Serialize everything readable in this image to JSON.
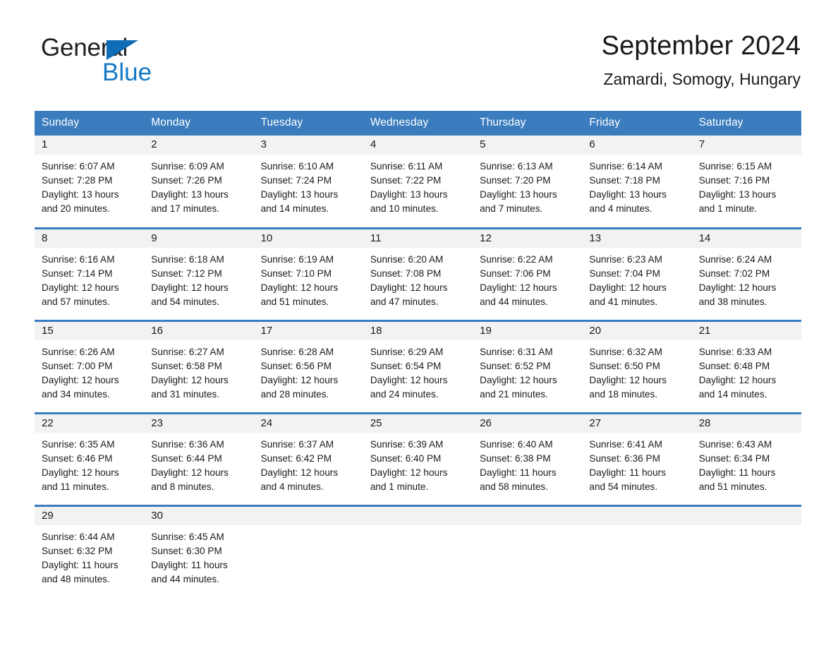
{
  "brand": {
    "name_primary": "General",
    "name_secondary": "Blue",
    "logo_icon": "triangle-flag-icon",
    "accent_color": "#1479c4"
  },
  "header": {
    "title": "September 2024",
    "subtitle": "Zamardi, Somogy, Hungary"
  },
  "theme": {
    "header_bar_color": "#3a7cbe",
    "day_cell_header_color": "#f2f2f2",
    "text_color": "#1a1a1a"
  },
  "weekday_headers": [
    "Sunday",
    "Monday",
    "Tuesday",
    "Wednesday",
    "Thursday",
    "Friday",
    "Saturday"
  ],
  "labels": {
    "sunrise_prefix": "Sunrise:",
    "sunset_prefix": "Sunset:",
    "daylight_prefix": "Daylight:"
  },
  "weeks": [
    {
      "days": [
        {
          "date": "1",
          "sunrise": "Sunrise: 6:07 AM",
          "sunset": "Sunset: 7:28 PM",
          "daylight_line1": "Daylight: 13 hours",
          "daylight_line2": "and 20 minutes."
        },
        {
          "date": "2",
          "sunrise": "Sunrise: 6:09 AM",
          "sunset": "Sunset: 7:26 PM",
          "daylight_line1": "Daylight: 13 hours",
          "daylight_line2": "and 17 minutes."
        },
        {
          "date": "3",
          "sunrise": "Sunrise: 6:10 AM",
          "sunset": "Sunset: 7:24 PM",
          "daylight_line1": "Daylight: 13 hours",
          "daylight_line2": "and 14 minutes."
        },
        {
          "date": "4",
          "sunrise": "Sunrise: 6:11 AM",
          "sunset": "Sunset: 7:22 PM",
          "daylight_line1": "Daylight: 13 hours",
          "daylight_line2": "and 10 minutes."
        },
        {
          "date": "5",
          "sunrise": "Sunrise: 6:13 AM",
          "sunset": "Sunset: 7:20 PM",
          "daylight_line1": "Daylight: 13 hours",
          "daylight_line2": "and 7 minutes."
        },
        {
          "date": "6",
          "sunrise": "Sunrise: 6:14 AM",
          "sunset": "Sunset: 7:18 PM",
          "daylight_line1": "Daylight: 13 hours",
          "daylight_line2": "and 4 minutes."
        },
        {
          "date": "7",
          "sunrise": "Sunrise: 6:15 AM",
          "sunset": "Sunset: 7:16 PM",
          "daylight_line1": "Daylight: 13 hours",
          "daylight_line2": "and 1 minute."
        }
      ]
    },
    {
      "days": [
        {
          "date": "8",
          "sunrise": "Sunrise: 6:16 AM",
          "sunset": "Sunset: 7:14 PM",
          "daylight_line1": "Daylight: 12 hours",
          "daylight_line2": "and 57 minutes."
        },
        {
          "date": "9",
          "sunrise": "Sunrise: 6:18 AM",
          "sunset": "Sunset: 7:12 PM",
          "daylight_line1": "Daylight: 12 hours",
          "daylight_line2": "and 54 minutes."
        },
        {
          "date": "10",
          "sunrise": "Sunrise: 6:19 AM",
          "sunset": "Sunset: 7:10 PM",
          "daylight_line1": "Daylight: 12 hours",
          "daylight_line2": "and 51 minutes."
        },
        {
          "date": "11",
          "sunrise": "Sunrise: 6:20 AM",
          "sunset": "Sunset: 7:08 PM",
          "daylight_line1": "Daylight: 12 hours",
          "daylight_line2": "and 47 minutes."
        },
        {
          "date": "12",
          "sunrise": "Sunrise: 6:22 AM",
          "sunset": "Sunset: 7:06 PM",
          "daylight_line1": "Daylight: 12 hours",
          "daylight_line2": "and 44 minutes."
        },
        {
          "date": "13",
          "sunrise": "Sunrise: 6:23 AM",
          "sunset": "Sunset: 7:04 PM",
          "daylight_line1": "Daylight: 12 hours",
          "daylight_line2": "and 41 minutes."
        },
        {
          "date": "14",
          "sunrise": "Sunrise: 6:24 AM",
          "sunset": "Sunset: 7:02 PM",
          "daylight_line1": "Daylight: 12 hours",
          "daylight_line2": "and 38 minutes."
        }
      ]
    },
    {
      "days": [
        {
          "date": "15",
          "sunrise": "Sunrise: 6:26 AM",
          "sunset": "Sunset: 7:00 PM",
          "daylight_line1": "Daylight: 12 hours",
          "daylight_line2": "and 34 minutes."
        },
        {
          "date": "16",
          "sunrise": "Sunrise: 6:27 AM",
          "sunset": "Sunset: 6:58 PM",
          "daylight_line1": "Daylight: 12 hours",
          "daylight_line2": "and 31 minutes."
        },
        {
          "date": "17",
          "sunrise": "Sunrise: 6:28 AM",
          "sunset": "Sunset: 6:56 PM",
          "daylight_line1": "Daylight: 12 hours",
          "daylight_line2": "and 28 minutes."
        },
        {
          "date": "18",
          "sunrise": "Sunrise: 6:29 AM",
          "sunset": "Sunset: 6:54 PM",
          "daylight_line1": "Daylight: 12 hours",
          "daylight_line2": "and 24 minutes."
        },
        {
          "date": "19",
          "sunrise": "Sunrise: 6:31 AM",
          "sunset": "Sunset: 6:52 PM",
          "daylight_line1": "Daylight: 12 hours",
          "daylight_line2": "and 21 minutes."
        },
        {
          "date": "20",
          "sunrise": "Sunrise: 6:32 AM",
          "sunset": "Sunset: 6:50 PM",
          "daylight_line1": "Daylight: 12 hours",
          "daylight_line2": "and 18 minutes."
        },
        {
          "date": "21",
          "sunrise": "Sunrise: 6:33 AM",
          "sunset": "Sunset: 6:48 PM",
          "daylight_line1": "Daylight: 12 hours",
          "daylight_line2": "and 14 minutes."
        }
      ]
    },
    {
      "days": [
        {
          "date": "22",
          "sunrise": "Sunrise: 6:35 AM",
          "sunset": "Sunset: 6:46 PM",
          "daylight_line1": "Daylight: 12 hours",
          "daylight_line2": "and 11 minutes."
        },
        {
          "date": "23",
          "sunrise": "Sunrise: 6:36 AM",
          "sunset": "Sunset: 6:44 PM",
          "daylight_line1": "Daylight: 12 hours",
          "daylight_line2": "and 8 minutes."
        },
        {
          "date": "24",
          "sunrise": "Sunrise: 6:37 AM",
          "sunset": "Sunset: 6:42 PM",
          "daylight_line1": "Daylight: 12 hours",
          "daylight_line2": "and 4 minutes."
        },
        {
          "date": "25",
          "sunrise": "Sunrise: 6:39 AM",
          "sunset": "Sunset: 6:40 PM",
          "daylight_line1": "Daylight: 12 hours",
          "daylight_line2": "and 1 minute."
        },
        {
          "date": "26",
          "sunrise": "Sunrise: 6:40 AM",
          "sunset": "Sunset: 6:38 PM",
          "daylight_line1": "Daylight: 11 hours",
          "daylight_line2": "and 58 minutes."
        },
        {
          "date": "27",
          "sunrise": "Sunrise: 6:41 AM",
          "sunset": "Sunset: 6:36 PM",
          "daylight_line1": "Daylight: 11 hours",
          "daylight_line2": "and 54 minutes."
        },
        {
          "date": "28",
          "sunrise": "Sunrise: 6:43 AM",
          "sunset": "Sunset: 6:34 PM",
          "daylight_line1": "Daylight: 11 hours",
          "daylight_line2": "and 51 minutes."
        }
      ]
    },
    {
      "days": [
        {
          "date": "29",
          "sunrise": "Sunrise: 6:44 AM",
          "sunset": "Sunset: 6:32 PM",
          "daylight_line1": "Daylight: 11 hours",
          "daylight_line2": "and 48 minutes."
        },
        {
          "date": "30",
          "sunrise": "Sunrise: 6:45 AM",
          "sunset": "Sunset: 6:30 PM",
          "daylight_line1": "Daylight: 11 hours",
          "daylight_line2": "and 44 minutes."
        },
        {
          "date": "",
          "sunrise": "",
          "sunset": "",
          "daylight_line1": "",
          "daylight_line2": ""
        },
        {
          "date": "",
          "sunrise": "",
          "sunset": "",
          "daylight_line1": "",
          "daylight_line2": ""
        },
        {
          "date": "",
          "sunrise": "",
          "sunset": "",
          "daylight_line1": "",
          "daylight_line2": ""
        },
        {
          "date": "",
          "sunrise": "",
          "sunset": "",
          "daylight_line1": "",
          "daylight_line2": ""
        },
        {
          "date": "",
          "sunrise": "",
          "sunset": "",
          "daylight_line1": "",
          "daylight_line2": ""
        }
      ]
    }
  ]
}
